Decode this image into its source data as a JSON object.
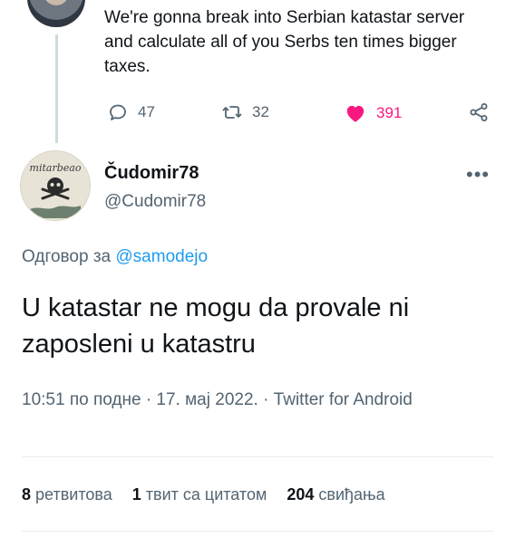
{
  "parent_tweet": {
    "text": "We're gonna break into Serbian katastar server and calculate all of you Serbs ten times bigger taxes.",
    "replies": "47",
    "retweets": "32",
    "likes": "391"
  },
  "reply_tweet": {
    "avatar_caption": "mitarbeao",
    "display_name": "Čudomir78",
    "handle": "@Cudomir78",
    "reply_to_label": "Одговор за",
    "reply_to_mention": "@samodejo",
    "text": "U katastar ne mogu da provale ni zaposleni u katastru",
    "timestamp": "10:51 по подне · 17. мај 2022. · Twitter for Android"
  },
  "stats": {
    "retweets_count": "8",
    "retweets_label": "ретвитова",
    "quotes_count": "1",
    "quotes_label": "твит са цитатом",
    "likes_count": "204",
    "likes_label": "свиђања"
  },
  "colors": {
    "text": "#0f1419",
    "secondary": "#536471",
    "link": "#1d9bf0",
    "like": "#f91880",
    "divider": "#e6ecf0"
  },
  "icons": [
    "reply-icon",
    "retweet-icon",
    "heart-icon",
    "share-icon",
    "more-icon"
  ]
}
